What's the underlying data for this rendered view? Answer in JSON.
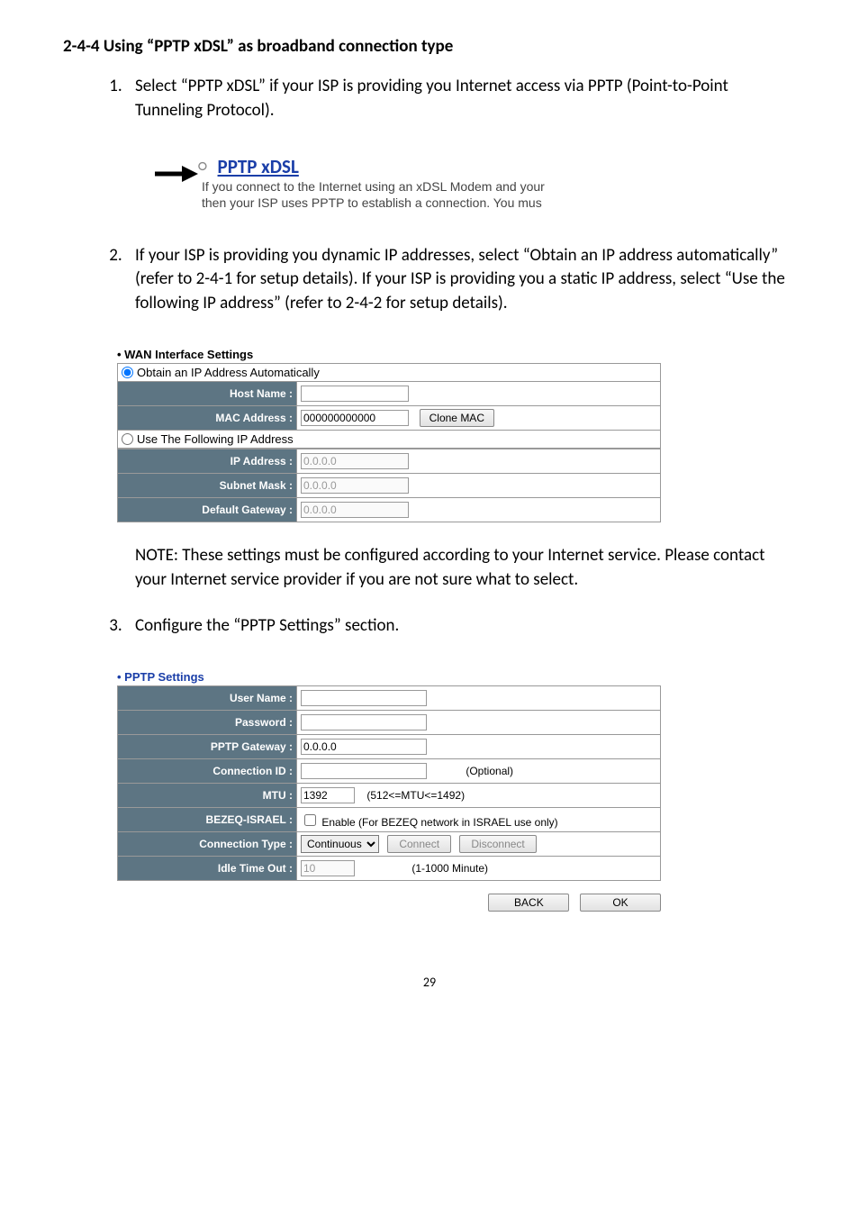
{
  "section_title": "2-4-4 Using “PPTP xDSL” as broadband connection type",
  "steps": {
    "s1": "Select “PPTP xDSL” if your ISP is providing you Internet access via PPTP (Point-to-Point Tunneling Protocol).",
    "s2": "If your ISP is providing you dynamic IP addresses, select “Obtain an IP address automatically” (refer to 2-4-1 for setup details). If your ISP is providing you a static IP address, select “Use the following IP address” (refer to 2-4-2 for setup details).",
    "s3": "Configure the “PPTP Settings” section."
  },
  "pptp_fig": {
    "title": "PPTP xDSL",
    "line1": "If you connect to the Internet using an xDSL Modem and your",
    "line2": "then your ISP uses PPTP to establish a connection. You mus"
  },
  "wan": {
    "title": "WAN Interface Settings",
    "radio_auto": "Obtain an IP Address Automatically",
    "radio_manual": "Use The Following IP Address",
    "labels": {
      "host": "Host Name :",
      "mac": "MAC Address :",
      "ip": "IP Address :",
      "subnet": "Subnet Mask :",
      "gateway": "Default Gateway :"
    },
    "values": {
      "host": "",
      "mac": "000000000000",
      "ip": "0.0.0.0",
      "subnet": "0.0.0.0",
      "gateway": "0.0.0.0"
    },
    "clone_mac": "Clone MAC"
  },
  "note": "NOTE: These settings must be configured according to your Internet service. Please contact your Internet service provider if you are not sure what to select.",
  "pptp": {
    "title": "PPTP Settings",
    "labels": {
      "user": "User Name :",
      "pass": "Password :",
      "gw": "PPTP Gateway :",
      "cid": "Connection ID :",
      "mtu": "MTU :",
      "bezeq": "BEZEQ-ISRAEL :",
      "ctype": "Connection Type :",
      "idle": "Idle Time Out :"
    },
    "values": {
      "user": "",
      "pass": "",
      "gw": "0.0.0.0",
      "cid": "",
      "mtu": "1392",
      "ctype": "Continuous",
      "idle": "10"
    },
    "optional": "(Optional)",
    "mtu_range": "(512<=MTU<=1492)",
    "bezeq_label": "Enable (For BEZEQ network in ISRAEL use only)",
    "connect": "Connect",
    "disconnect": "Disconnect",
    "idle_range": "(1-1000 Minute)"
  },
  "buttons": {
    "back": "BACK",
    "ok": "OK"
  },
  "page_number": "29"
}
